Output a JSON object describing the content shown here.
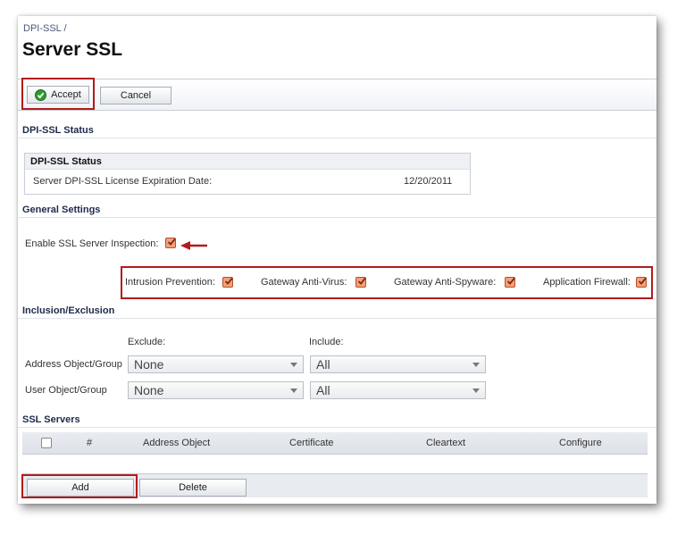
{
  "breadcrumb": "DPI-SSL /",
  "page_title": "Server SSL",
  "toolbar": {
    "accept_label": "Accept",
    "cancel_label": "Cancel"
  },
  "status_section": {
    "heading": "DPI-SSL Status",
    "box_title": "DPI-SSL Status",
    "row_label": "Server DPI-SSL License Expiration Date:",
    "row_value": "12/20/2011"
  },
  "general_settings": {
    "heading": "General Settings",
    "enable_label": "Enable SSL Server Inspection:",
    "enable_checked": true,
    "services": [
      {
        "label": "Intrusion Prevention:",
        "checked": true
      },
      {
        "label": "Gateway Anti-Virus:",
        "checked": true
      },
      {
        "label": "Gateway Anti-Spyware:",
        "checked": true
      },
      {
        "label": "Application Firewall:",
        "checked": true
      }
    ]
  },
  "inclusion": {
    "heading": "Inclusion/Exclusion",
    "exclude_header": "Exclude:",
    "include_header": "Include:",
    "rows": [
      {
        "label": "Address Object/Group",
        "exclude": "None",
        "include": "All"
      },
      {
        "label": "User Object/Group",
        "exclude": "None",
        "include": "All"
      }
    ]
  },
  "ssl_servers": {
    "heading": "SSL Servers",
    "columns": [
      "#",
      "Address Object",
      "Certificate",
      "Cleartext",
      "Configure"
    ],
    "add_label": "Add",
    "delete_label": "Delete"
  },
  "colors": {
    "accent_red": "#b31b1b",
    "checkbox_orange": "#f2a07a",
    "heading_navy": "#1d2b4a"
  }
}
